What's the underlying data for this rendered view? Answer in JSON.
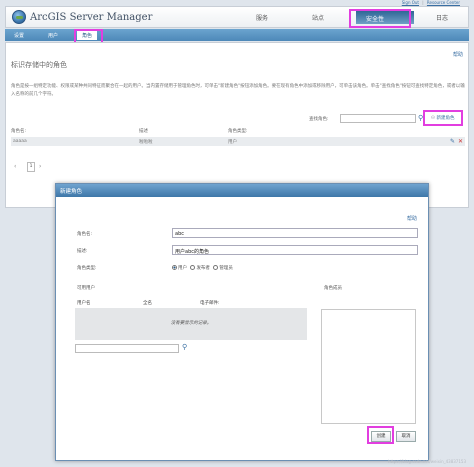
{
  "top_links": {
    "sign_out": "Sign Out",
    "separator": "|",
    "resource_center": "Resource Center"
  },
  "header": {
    "app_title": "ArcGIS Server Manager"
  },
  "main_nav": {
    "services": "服务",
    "site": "站点",
    "security": "安全性",
    "logs": "日志"
  },
  "sub_nav": {
    "settings": "设置",
    "users": "用户",
    "roles": "角色"
  },
  "page": {
    "help": "帮助",
    "title": "标识存储中的角色",
    "description": "角色是按一组特定功能、权限或某种共同特征而聚合在一起的用户。当内置存储用于管理角色时，可单击\"新建角色\"按钮添加角色。要在现有角色中添加或移除用户，可单击该角色。单击\"查找角色\"按钮可查找特定角色，或者以输入名称的前几个字符。",
    "search_label": "查找角色:",
    "search_value": "",
    "new_role_button": "新建角色"
  },
  "roles_table": {
    "headers": [
      "角色名:",
      "描述",
      "角色类型:"
    ],
    "rows": [
      {
        "name": "aaaaa",
        "description": "啦啦啦",
        "type": "用户"
      }
    ]
  },
  "pager": {
    "prev": "‹",
    "page": "1",
    "next": "›"
  },
  "dialog": {
    "title": "新建角色",
    "help": "帮助",
    "role_name_label": "角色名:",
    "role_name_value": "abc",
    "description_label": "描述:",
    "description_value": "用户abc的角色",
    "role_type_label": "角色类型:",
    "role_types": [
      "用户",
      "发布者",
      "管理员"
    ],
    "selected_role_type": "用户",
    "available_users_label": "可用用户",
    "role_members_label": "角色成员",
    "user_columns": [
      "用户名",
      "全名",
      "电子邮件:"
    ],
    "no_users_message": "没有要显示的记录。",
    "user_search_value": "",
    "create_button": "创建",
    "cancel_button": "取消"
  },
  "watermark": "https://blog.csdn.net/weixin_43837153",
  "colors": {
    "highlight": "#e23ee0",
    "nav_active": "#2f6796",
    "link": "#3a6fa3"
  }
}
